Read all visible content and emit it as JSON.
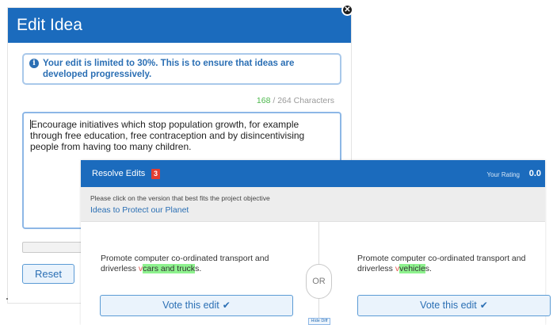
{
  "edit_dialog": {
    "title": "Edit Idea",
    "close_glyph": "✕",
    "info_icon": "i",
    "info_text": "Your edit is limited to 30%. This is to ensure that ideas are developed progressively.",
    "char_used": "168",
    "char_total": " / 264 Characters",
    "idea_text": "Encourage initiatives which stop population growth, for example through free education, free contraception and by disincentivising people from having too many children.",
    "reset_label": "Reset"
  },
  "resolve_edits": {
    "title": "Resolve Edits",
    "edit_count": "3",
    "rating_label": "Your Rating",
    "rating_value": "0.0",
    "objective_hint": "Please click on the version that best fits the project objective",
    "project_link": "Ideas to Protect our Planet",
    "or_label": "OR",
    "hide_diff_label": "Hide Diff",
    "version_a": {
      "prefix": "Promote computer co-ordinated transport and driverless ",
      "deleted": "v",
      "inserted": "cars and truck",
      "suffix": "s."
    },
    "version_b": {
      "prefix": "Promote computer co-ordinated transport and driverless ",
      "deleted": "v",
      "inserted": "vehicle",
      "suffix": "s."
    },
    "vote_label": "Vote this edit",
    "vote_icon": "✔"
  },
  "colors": {
    "header_blue": "#1b6bbd",
    "link_blue": "#2b6fb4",
    "insert_green": "#8ef28e",
    "delete_red": "#e2574c",
    "badge_red": "#e43d30",
    "count_green": "#4cb84c"
  },
  "icons": {
    "close": "close-icon",
    "info": "info-icon",
    "check": "check-icon"
  }
}
